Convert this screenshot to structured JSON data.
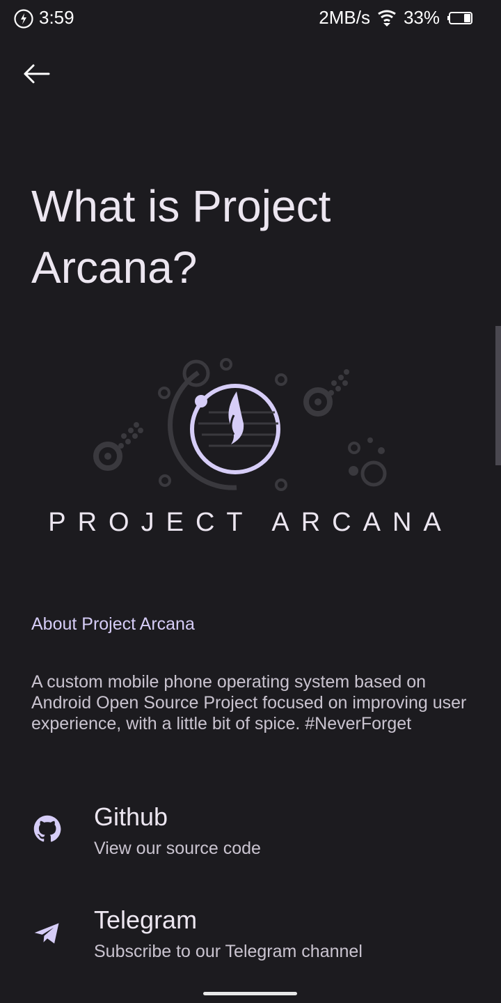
{
  "status_bar": {
    "time": "3:59",
    "network_speed": "2MB/s",
    "battery": "33%"
  },
  "header": {
    "back_icon": "arrow-left-icon"
  },
  "page": {
    "title": "What is Project Arcana?",
    "logo_text": "PROJECT ARCANA"
  },
  "about": {
    "heading": "About Project Arcana",
    "body": "A custom mobile phone operating system based on Android Open Source Project focused on improving user experience, with a little bit of spice. #NeverForget"
  },
  "links": [
    {
      "title": "Github",
      "subtitle": "View our source code",
      "icon": "github-icon"
    },
    {
      "title": "Telegram",
      "subtitle": "Subscribe to our Telegram channel",
      "icon": "telegram-icon"
    }
  ],
  "colors": {
    "background": "#1c1b1f",
    "accent": "#d6cdf7",
    "logo_dim": "#3a393e"
  }
}
